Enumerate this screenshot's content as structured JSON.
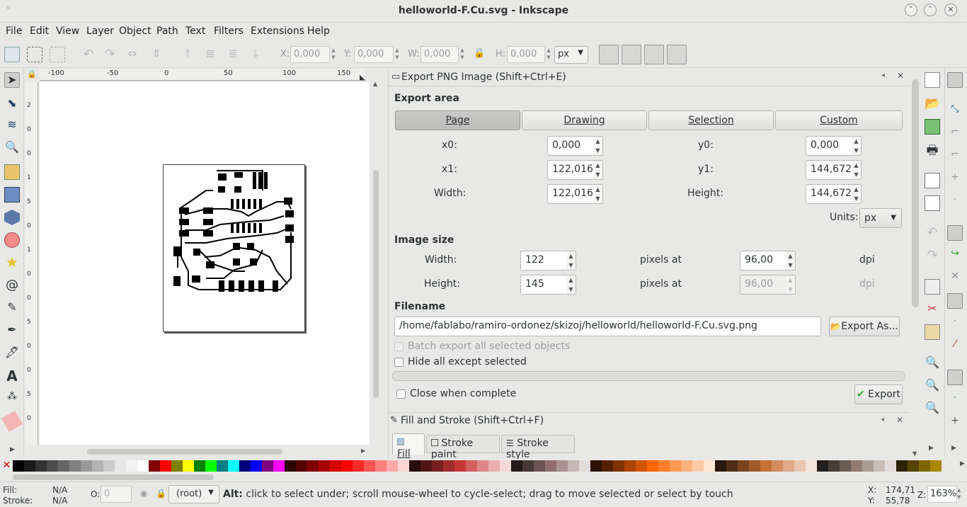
{
  "window": {
    "title": "helloworld-F.Cu.svg - Inkscape"
  },
  "menu": [
    "File",
    "Edit",
    "View",
    "Layer",
    "Object",
    "Path",
    "Text",
    "Filters",
    "Extensions",
    "Help"
  ],
  "toolbar": {
    "x_label": "X:",
    "x_value": "0,000",
    "y_label": "Y:",
    "y_value": "0,000",
    "w_label": "W:",
    "w_value": "0,000",
    "h_label": "H:",
    "h_value": "0,000",
    "unit": "px"
  },
  "ruler": {
    "top_ticks": [
      "-100",
      "-50",
      "0",
      "50",
      "100",
      "150"
    ],
    "left_ticks": [
      "2",
      "0",
      "0",
      "1",
      "5",
      "0",
      "1",
      "0",
      "0",
      "5",
      "0",
      "0",
      "5",
      "0"
    ]
  },
  "export_panel": {
    "title": "Export PNG Image (Shift+Ctrl+E)",
    "export_area_label": "Export area",
    "area_buttons": [
      "Page",
      "Drawing",
      "Selection",
      "Custom"
    ],
    "active_area": "Page",
    "x0_label": "x0:",
    "x0": "0,000",
    "y0_label": "y0:",
    "y0": "0,000",
    "x1_label": "x1:",
    "x1": "122,016",
    "y1_label": "y1:",
    "y1": "144,672",
    "width_label": "Width:",
    "width": "122,016",
    "height_label": "Height:",
    "height": "144,672",
    "units_label": "Units:",
    "units": "px",
    "image_size_label": "Image size",
    "img_width_label": "Width:",
    "img_width": "122",
    "img_height_label": "Height:",
    "img_height": "145",
    "pixels_at": "pixels at",
    "dpi_value": "96,00",
    "dpi_value2": "96,00",
    "dpi_label": "dpi",
    "filename_label": "Filename",
    "filename": "/home/fablabo/ramiro-ordonez/skizoj/helloworld/helloworld-F.Cu.svg.png",
    "export_as_label": "Export As...",
    "batch_label": "Batch export all selected objects",
    "hide_label": "Hide all except selected",
    "close_label": "Close when complete",
    "export_label": "Export"
  },
  "fill_stroke_panel": {
    "title": "Fill and Stroke (Shift+Ctrl+F)",
    "tabs": [
      "Fill",
      "Stroke paint",
      "Stroke style"
    ]
  },
  "status": {
    "fill_label": "Fill:",
    "fill_value": "N/A",
    "stroke_label": "Stroke:",
    "stroke_value": "N/A",
    "opacity_label": "O:",
    "opacity_value": "0",
    "layer": "(root)",
    "message_bold": "Alt:",
    "message": " click to select under; scroll mouse-wheel to cycle-select; drag to move selected or select by touch",
    "x_label": "X:",
    "x_value": "174,71",
    "y_label": "Y:",
    "y_value": "55,78",
    "zoom_label": "Z:",
    "zoom_value": "163%"
  },
  "palette_colors": [
    "#000000",
    "#1a1a1a",
    "#333333",
    "#4d4d4d",
    "#666666",
    "#808080",
    "#999999",
    "#b3b3b3",
    "#cccccc",
    "#e6e6e6",
    "#f2f2f2",
    "#ffffff",
    "#800000",
    "#ff0000",
    "#808000",
    "#ffff00",
    "#008000",
    "#00ff00",
    "#008080",
    "#00ffff",
    "#000080",
    "#0000ff",
    "#800080",
    "#ff00ff",
    "#2b0000",
    "#550000",
    "#800000",
    "#aa0000",
    "#d40000",
    "#ff0000",
    "#ff2a2a",
    "#ff5555",
    "#ff8080",
    "#ffaaaa",
    "#ffd5d5",
    "#280b0b",
    "#501616",
    "#782121",
    "#a02c2c",
    "#c83737",
    "#d35f5f",
    "#de8787",
    "#e9afaf",
    "#f4d7d7",
    "#241c1c",
    "#483737",
    "#6c5353",
    "#916f6f",
    "#ac9393",
    "#c8b7b7",
    "#e3dbdb",
    "#2b1100",
    "#552200",
    "#803300",
    "#aa4400",
    "#d45500",
    "#ff6600",
    "#ff7f2a",
    "#ff9955",
    "#ffb380",
    "#ffccaa",
    "#ffe6d5",
    "#28170b",
    "#502d16",
    "#784421",
    "#a05a2c",
    "#c87137",
    "#d38d5f",
    "#deaa87",
    "#e9c6af",
    "#f4e3d7",
    "#241f1c",
    "#483e37",
    "#6c5d53",
    "#917c6f",
    "#ac9d93",
    "#c8beb7",
    "#e3dedb",
    "#2b2200",
    "#554400",
    "#806600",
    "#aa8800"
  ]
}
